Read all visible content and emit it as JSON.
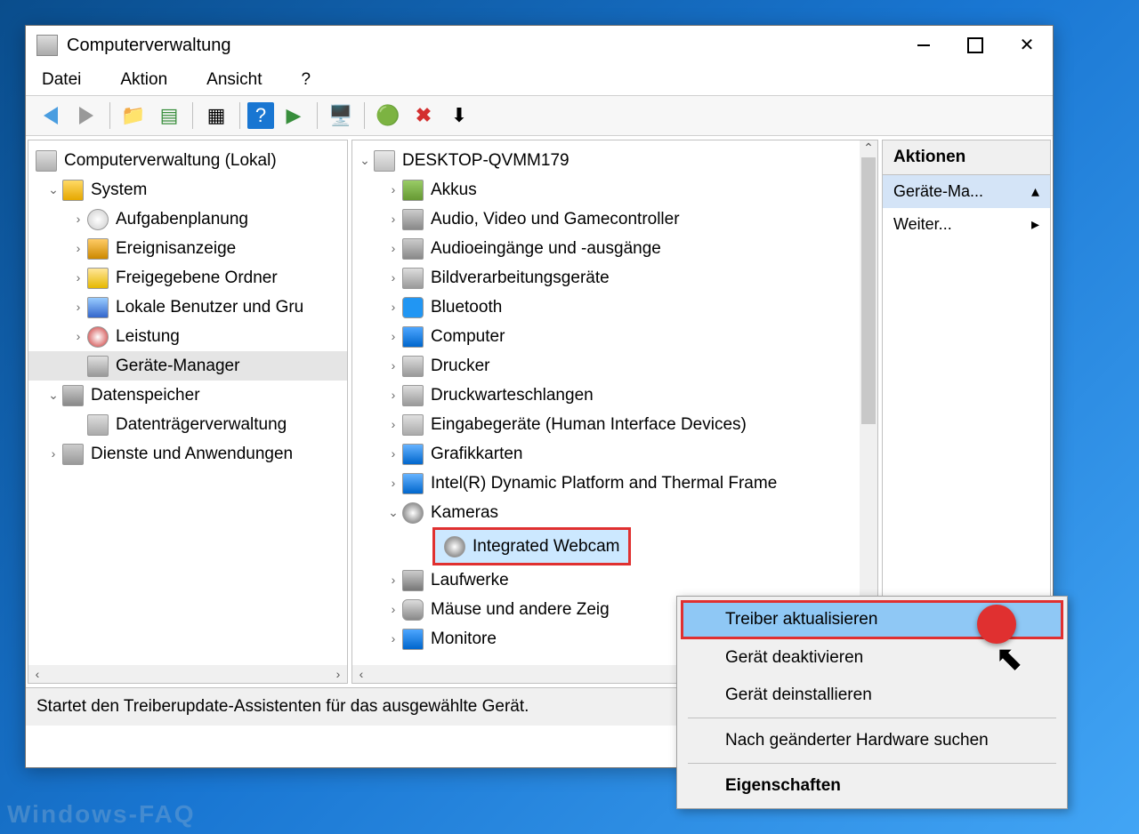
{
  "window": {
    "title": "Computerverwaltung"
  },
  "menu": {
    "file": "Datei",
    "action": "Aktion",
    "view": "Ansicht",
    "help": "?"
  },
  "left_tree": {
    "root": "Computerverwaltung (Lokal)",
    "system": "System",
    "system_items": {
      "scheduler": "Aufgabenplanung",
      "eventviewer": "Ereignisanzeige",
      "shared": "Freigegebene Ordner",
      "users": "Lokale Benutzer und Gru",
      "perf": "Leistung",
      "devmgr": "Geräte-Manager"
    },
    "storage": "Datenspeicher",
    "storage_items": {
      "diskmgmt": "Datenträgerverwaltung"
    },
    "services": "Dienste und Anwendungen"
  },
  "mid_tree": {
    "root": "DESKTOP-QVMM179",
    "items": {
      "battery": "Akkus",
      "avgame": "Audio, Video und Gamecontroller",
      "audio": "Audioeingänge und -ausgänge",
      "imaging": "Bildverarbeitungsgeräte",
      "bluetooth": "Bluetooth",
      "computer": "Computer",
      "printers": "Drucker",
      "printqueue": "Druckwarteschlangen",
      "hid": "Eingabegeräte (Human Interface Devices)",
      "gpu": "Grafikkarten",
      "intel": "Intel(R) Dynamic Platform and Thermal Frame",
      "cameras": "Kameras",
      "webcam": "Integrated Webcam",
      "drives": "Laufwerke",
      "mice": "Mäuse und andere Zeig",
      "monitors": "Monitore"
    }
  },
  "actions_pane": {
    "header": "Aktionen",
    "item1": "Geräte-Ma...",
    "item2": "Weiter..."
  },
  "context_menu": {
    "update": "Treiber aktualisieren",
    "disable": "Gerät deaktivieren",
    "uninstall": "Gerät deinstallieren",
    "scan": "Nach geänderter Hardware suchen",
    "props": "Eigenschaften"
  },
  "statusbar": "Startet den Treiberupdate-Assistenten für das ausgewählte Gerät.",
  "watermark": "Windows-FAQ"
}
